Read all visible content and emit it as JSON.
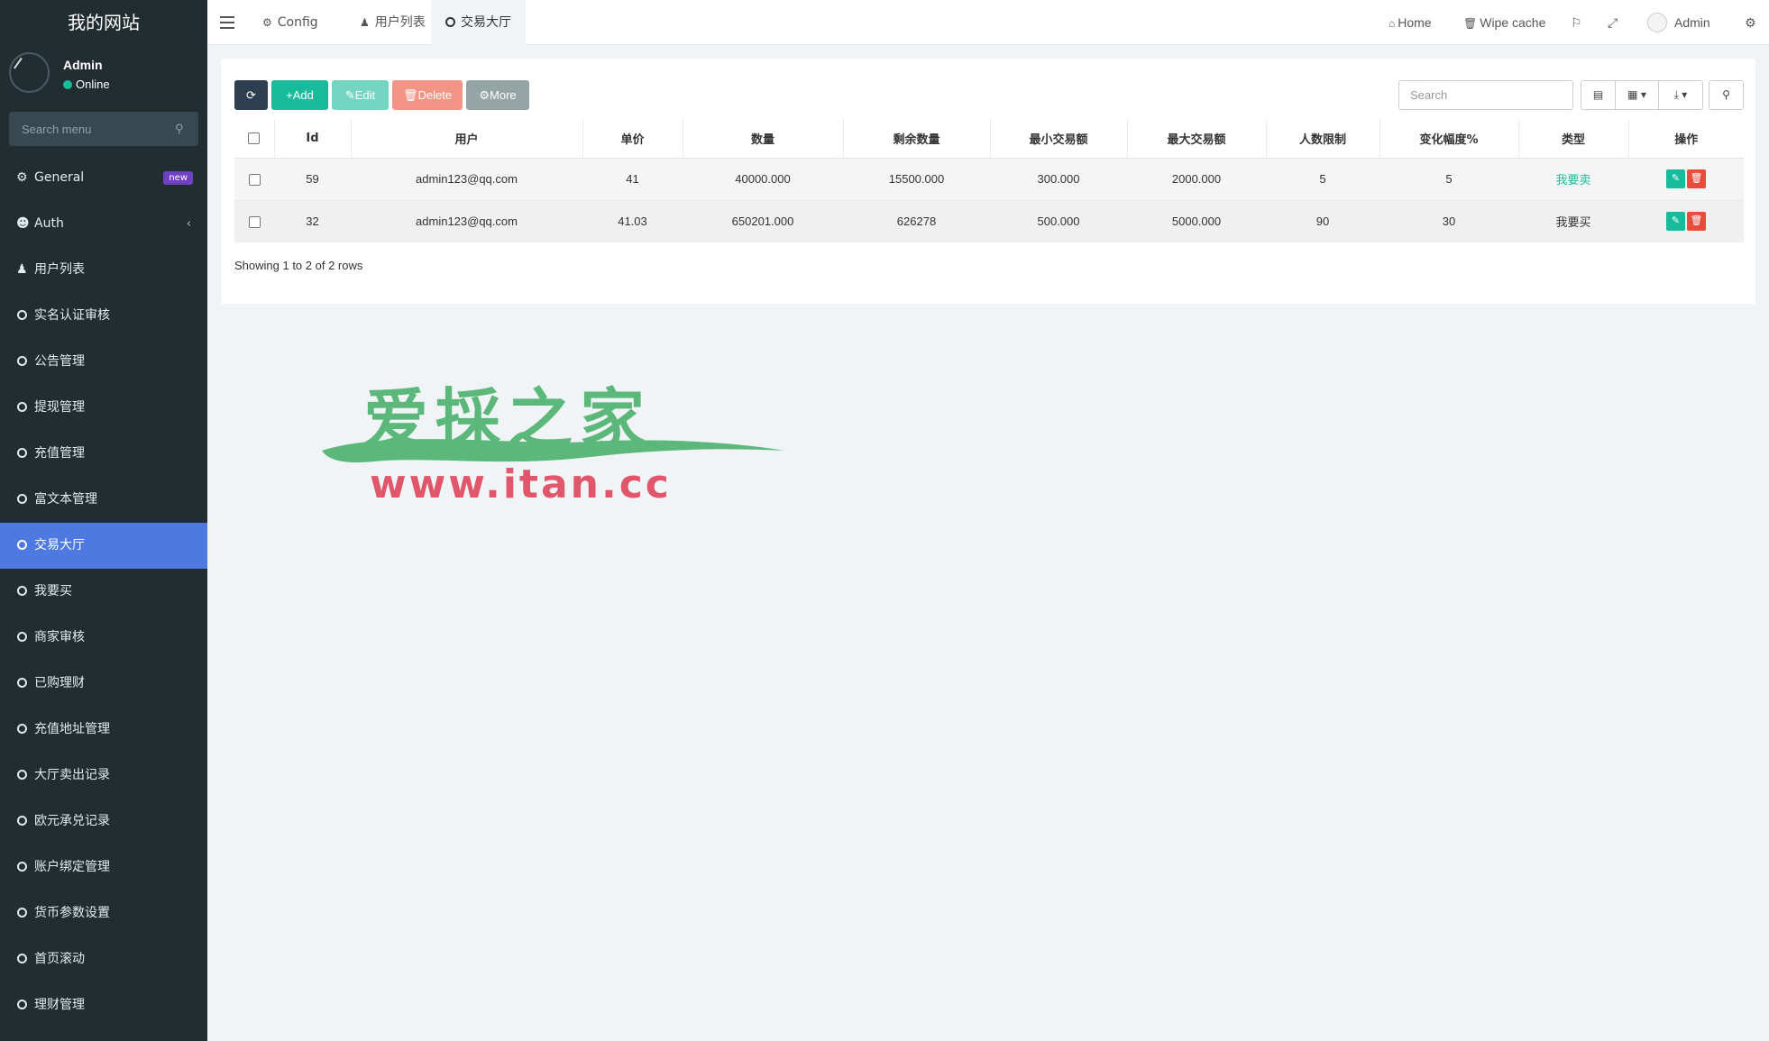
{
  "app": {
    "site_title": "我的网站"
  },
  "user_panel": {
    "name": "Admin",
    "status": "Online"
  },
  "sidebar": {
    "search_placeholder": "Search menu",
    "items": [
      {
        "label": "General",
        "icon": "gears-icon",
        "badge": "new"
      },
      {
        "label": "Auth",
        "icon": "users-icon",
        "chevron": "‹"
      },
      {
        "label": "用户列表",
        "icon": "user-icon"
      },
      {
        "label": "实名认证审核",
        "icon": "circle-icon"
      },
      {
        "label": "公告管理",
        "icon": "circle-icon"
      },
      {
        "label": "提现管理",
        "icon": "circle-icon"
      },
      {
        "label": "充值管理",
        "icon": "circle-icon"
      },
      {
        "label": "富文本管理",
        "icon": "circle-icon"
      },
      {
        "label": "交易大厅",
        "icon": "circle-icon",
        "active": true
      },
      {
        "label": "我要买",
        "icon": "circle-icon"
      },
      {
        "label": "商家审核",
        "icon": "circle-icon"
      },
      {
        "label": "已购理财",
        "icon": "circle-icon"
      },
      {
        "label": "充值地址管理",
        "icon": "circle-icon"
      },
      {
        "label": "大厅卖出记录",
        "icon": "circle-icon"
      },
      {
        "label": "欧元承兑记录",
        "icon": "circle-icon"
      },
      {
        "label": "账户绑定管理",
        "icon": "circle-icon"
      },
      {
        "label": "货币参数设置",
        "icon": "circle-icon"
      },
      {
        "label": "首页滚动",
        "icon": "circle-icon"
      },
      {
        "label": "理财管理",
        "icon": "circle-icon"
      }
    ]
  },
  "topbar": {
    "tabs": [
      {
        "label": "Config",
        "icon": "gear-icon"
      },
      {
        "label": "用户列表",
        "icon": "user-icon"
      },
      {
        "label": "交易大厅",
        "icon": "circle-icon",
        "active": true
      }
    ],
    "home_label": "Home",
    "wipe_cache_label": "Wipe cache",
    "admin_label": "Admin"
  },
  "toolbar": {
    "add_label": "Add",
    "edit_label": "Edit",
    "delete_label": "Delete",
    "more_label": "More",
    "search_placeholder": "Search"
  },
  "table": {
    "columns": [
      "Id",
      "用户",
      "单价",
      "数量",
      "剩余数量",
      "最小交易额",
      "最大交易额",
      "人数限制",
      "变化幅度%",
      "类型",
      "操作"
    ],
    "rows": [
      {
        "id": "59",
        "user": "admin123@qq.com",
        "price": "41",
        "quantity": "40000.000",
        "remaining": "15500.000",
        "min_amount": "300.000",
        "max_amount": "2000.000",
        "limit": "5",
        "change": "5",
        "type": "我要卖",
        "type_color": "#18bc9c"
      },
      {
        "id": "32",
        "user": "admin123@qq.com",
        "price": "41.03",
        "quantity": "650201.000",
        "remaining": "626278",
        "min_amount": "500.000",
        "max_amount": "5000.000",
        "limit": "90",
        "change": "30",
        "type": "我要买",
        "type_color": "#333333"
      }
    ],
    "pagination_text": "Showing 1 to 2 of 2 rows"
  },
  "watermark": {
    "title": "爱採之家",
    "url": "www.itan.cc"
  },
  "colors": {
    "sidebar_bg": "#222d32",
    "active_menu": "#4d79e0",
    "success": "#18bc9c",
    "danger": "#e74c3c",
    "primary_dark": "#2c3e50"
  }
}
